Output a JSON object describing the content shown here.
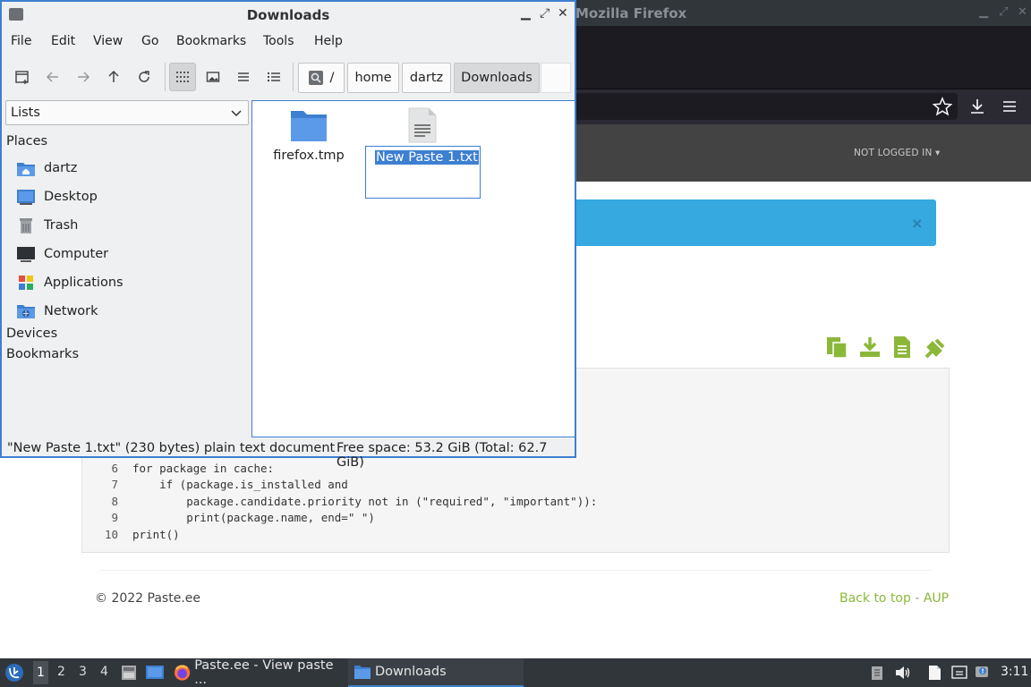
{
  "firefox": {
    "title": "Mozilla Firefox",
    "account": "NOT LOGGED IN",
    "alert_close": "×",
    "code_lines": [
      {
        "num": "6",
        "text": "for package in cache:"
      },
      {
        "num": "7",
        "text": "    if (package.is_installed and"
      },
      {
        "num": "8",
        "text": "        package.candidate.priority not in (\"required\", \"important\")):"
      },
      {
        "num": "9",
        "text": "        print(package.name, end=\" \")"
      },
      {
        "num": "10",
        "text": "print()"
      }
    ],
    "footer": {
      "copyright": "© 2022 Paste.ee",
      "back_to_top": "Back to top",
      "separator": "-",
      "aup": "AUP"
    }
  },
  "file_manager": {
    "title": "Downloads",
    "menu": [
      "File",
      "Edit",
      "View",
      "Go",
      "Bookmarks",
      "Tools",
      "Help"
    ],
    "breadcrumbs": [
      "/",
      "home",
      "dartz",
      "Downloads"
    ],
    "sidebar": {
      "selector": "Lists",
      "places_header": "Places",
      "places": [
        {
          "label": "dartz",
          "icon": "home-folder-icon"
        },
        {
          "label": "Desktop",
          "icon": "desktop-icon"
        },
        {
          "label": "Trash",
          "icon": "trash-icon"
        },
        {
          "label": "Computer",
          "icon": "computer-icon"
        },
        {
          "label": "Applications",
          "icon": "applications-icon"
        },
        {
          "label": "Network",
          "icon": "network-icon"
        }
      ],
      "devices_header": "Devices",
      "bookmarks_header": "Bookmarks"
    },
    "files": [
      {
        "name": "firefox.tmp",
        "type": "folder"
      },
      {
        "name": "New Paste 1.txt",
        "type": "text",
        "renaming": true
      }
    ],
    "status": {
      "selection": "\"New Paste 1.txt\" (230 bytes) plain text document",
      "free_space": "Free space: 53.2 GiB (Total: 62.7 GiB)"
    }
  },
  "taskbar": {
    "workspaces": [
      "1",
      "2",
      "3",
      "4"
    ],
    "active_workspace": "1",
    "tasks": [
      {
        "label": "Paste.ee - View paste ...",
        "icon": "firefox-icon"
      },
      {
        "label": "Downloads",
        "icon": "folder-icon"
      }
    ],
    "clock": "3:11"
  },
  "colors": {
    "accent": "#3d7fd1",
    "site_green": "#8cb83a",
    "alert_blue": "#35a9e0",
    "panel_dark": "#31363b"
  }
}
